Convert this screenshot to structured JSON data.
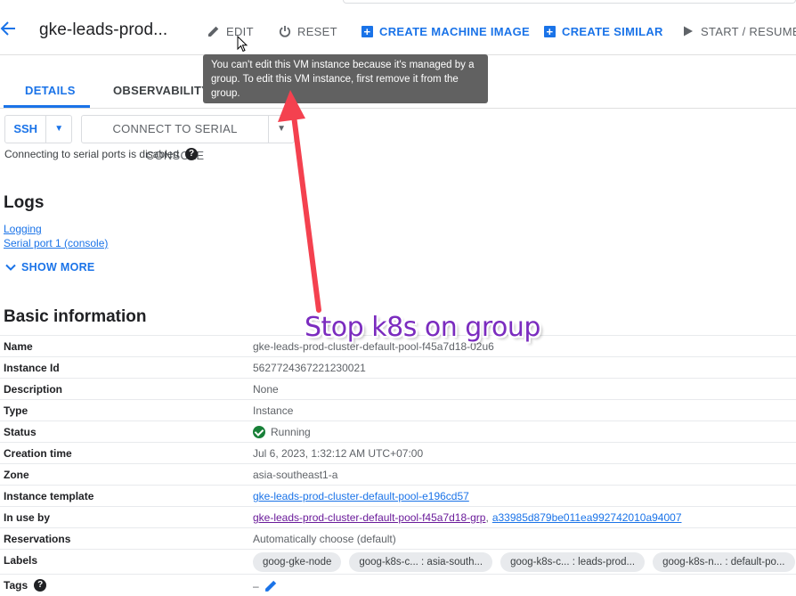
{
  "header": {
    "title": "gke-leads-prod...",
    "edit_label": "EDIT",
    "reset_label": "RESET",
    "create_machine_image_label": "CREATE MACHINE IMAGE",
    "create_similar_label": "CREATE SIMILAR",
    "start_resume_label": "START / RESUME"
  },
  "tooltip": {
    "text": "You can't edit this VM instance because it's managed by a group. To edit this VM instance, first remove it from the group."
  },
  "tabs": [
    {
      "label": "DETAILS",
      "active": true
    },
    {
      "label": "OBSERVABILITY",
      "active": false
    }
  ],
  "connect": {
    "ssh_label": "SSH",
    "serial_label": "CONNECT TO SERIAL CONSOLE",
    "serial_note": "Connecting to serial ports is disabled"
  },
  "logs": {
    "heading": "Logs",
    "links": [
      "Logging",
      "Serial port 1 (console)"
    ],
    "show_more": "SHOW MORE"
  },
  "basic_info": {
    "heading": "Basic information",
    "rows": {
      "name": {
        "key": "Name",
        "value": "gke-leads-prod-cluster-default-pool-f45a7d18-02u6"
      },
      "instance_id": {
        "key": "Instance Id",
        "value": "5627724367221230021"
      },
      "description": {
        "key": "Description",
        "value": "None"
      },
      "type": {
        "key": "Type",
        "value": "Instance"
      },
      "status": {
        "key": "Status",
        "value": "Running"
      },
      "creation_time": {
        "key": "Creation time",
        "value": "Jul 6, 2023, 1:32:12 AM UTC+07:00"
      },
      "zone": {
        "key": "Zone",
        "value": "asia-southeast1-a"
      },
      "instance_template": {
        "key": "Instance template",
        "value": "gke-leads-prod-cluster-default-pool-e196cd57"
      },
      "in_use_by": {
        "key": "In use by",
        "value_1": "gke-leads-prod-cluster-default-pool-f45a7d18-grp",
        "separator": ",",
        "value_2": "a33985d879be011ea992742010a94007"
      },
      "reservations": {
        "key": "Reservations",
        "value": "Automatically choose (default)"
      },
      "labels": {
        "key": "Labels",
        "chips": [
          "goog-gke-node",
          "goog-k8s-c... : asia-south...",
          "goog-k8s-c... : leads-prod...",
          "goog-k8s-n... : default-po..."
        ]
      },
      "tags": {
        "key": "Tags",
        "value": "–"
      }
    }
  },
  "annotation": {
    "text": "Stop k8s on group"
  },
  "colors": {
    "accent": "#1a73e8",
    "status_running": "#188038",
    "tooltip_bg": "#616161",
    "annotation_arrow": "#f4414f",
    "annotation_text": "#7b2cbf"
  },
  "icons": {
    "back": "arrow-left-icon",
    "edit": "pencil-icon",
    "reset": "power-icon",
    "create": "plus-box-icon",
    "start": "play-icon",
    "caret": "caret-down-icon",
    "help": "help-circle-icon",
    "show_more": "chevron-down-icon",
    "status": "check-circle-icon"
  }
}
